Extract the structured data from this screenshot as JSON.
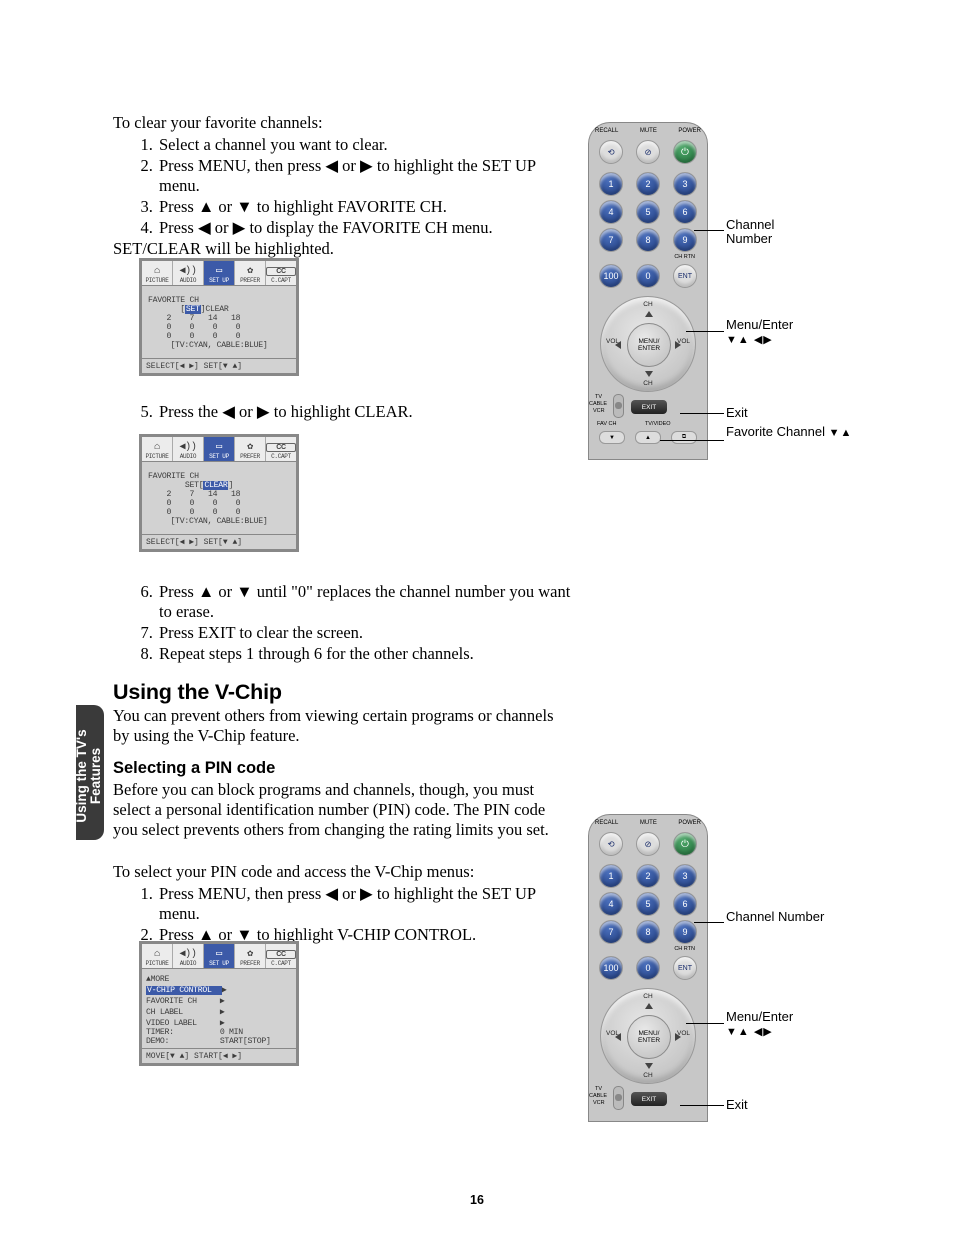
{
  "page_number": "16",
  "side_tab": "Using the TV's Features",
  "intro": "To clear your favorite channels:",
  "steps_a": [
    "Select a channel you want to clear.",
    "Press MENU, then press ◀ or ▶ to highlight the SET UP menu.",
    "Press ▲ or ▼ to highlight FAVORITE CH.",
    "Press ◀ or ▶ to display the FAVORITE CH menu."
  ],
  "step4_sub": "SET/CLEAR will be highlighted.",
  "step5": "Press the ◀ or ▶ to highlight CLEAR.",
  "steps_b": [
    "Press ▲ or ▼ until \"0\" replaces the channel number you want to erase.",
    "Press EXIT to clear the screen.",
    "Repeat steps 1 through 6 for the other channels."
  ],
  "vchip": {
    "heading": "Using the V-Chip",
    "intro": "You can prevent others from viewing certain programs or channels by using the V-Chip feature.",
    "sub_heading": "Selecting a PIN code",
    "sub_intro": "Before you can block programs and channels, though, you must select a personal identification number (PIN) code. The PIN code you select prevents others from changing the rating limits you set.",
    "lead": "To select your PIN code and access the V-Chip menus:",
    "steps": [
      "Press MENU, then press ◀ or ▶ to highlight the SET UP menu.",
      "Press ▲ or ▼ to highlight V-CHIP CONTROL."
    ]
  },
  "osd": {
    "tabs": [
      "PICTURE",
      "AUDIO",
      "SET UP",
      "PREFER",
      "C.CAPT"
    ],
    "fav_title": "FAVORITE CH",
    "set_label": "SET",
    "clear_label": "CLEAR",
    "grid_rows": [
      "    2    7   14   18",
      "    0    0    0    0",
      "    0    0    0    0"
    ],
    "legend": "[TV:CYAN, CABLE:BLUE]",
    "footer_fav": "SELECT[◀ ▶] SET[▼ ▲]",
    "more_title": "▲MORE",
    "menu_rows": [
      {
        "label": "V-CHIP CONTROL",
        "suffix": "▶",
        "hl": true
      },
      {
        "label": "FAVORITE CH",
        "suffix": "▶"
      },
      {
        "label": "CH LABEL",
        "suffix": "▶"
      },
      {
        "label": "VIDEO LABEL",
        "suffix": "▶"
      },
      {
        "label": "TIMER:",
        "suffix": "0 MIN"
      },
      {
        "label": "DEMO:",
        "suffix": "START[STOP]"
      }
    ],
    "footer_more": "MOVE[▼ ▲] START[◀ ▶]"
  },
  "remote": {
    "top_labels": [
      "RECALL",
      "MUTE",
      "POWER"
    ],
    "numbers": [
      "1",
      "2",
      "3",
      "4",
      "5",
      "6",
      "7",
      "8",
      "9",
      "100",
      "0",
      "ENT"
    ],
    "chrtn": "CH RTN",
    "dpad": {
      "center1": "MENU/",
      "center2": "ENTER",
      "up": "CH",
      "down": "CH",
      "left": "VOL",
      "right": "VOL"
    },
    "switch": [
      "TV",
      "CABLE",
      "VCR"
    ],
    "exit": "EXIT",
    "fav_labels": [
      "FAV CH",
      "TV/VIDEO"
    ]
  },
  "callouts": {
    "channel_number": "Channel Number",
    "menu_enter": "Menu/Enter",
    "exit": "Exit",
    "favorite_channel": "Favorite Channel",
    "arrows_ud": "▼▲",
    "arrows_lr": "◀▶",
    "arrows_combo": "▼▲ ◀▶"
  }
}
